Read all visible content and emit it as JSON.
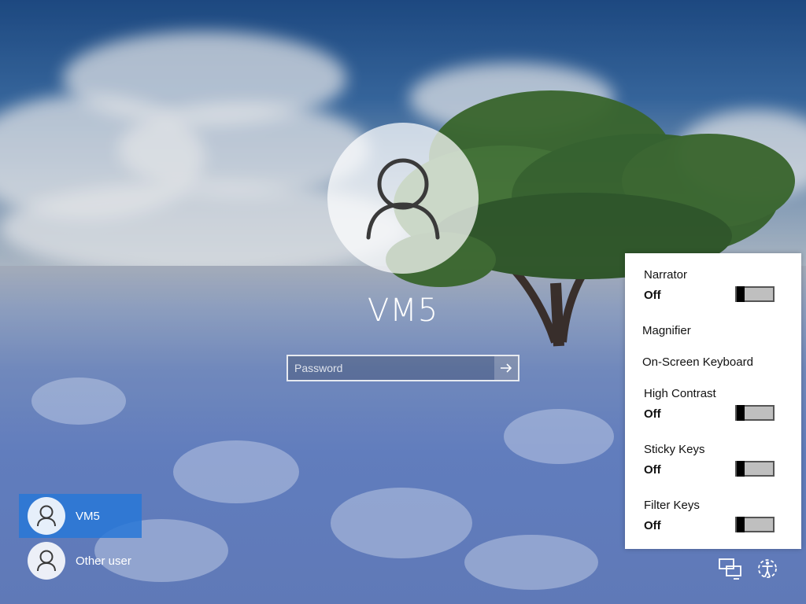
{
  "login": {
    "username": "VM5",
    "password_placeholder": "Password"
  },
  "users": [
    {
      "name": "VM5",
      "selected": true
    },
    {
      "name": "Other user",
      "selected": false
    }
  ],
  "ease_of_access": {
    "narrator": {
      "label": "Narrator",
      "state": "Off"
    },
    "magnifier": {
      "label": "Magnifier"
    },
    "onscreen_keyboard": {
      "label": "On-Screen Keyboard"
    },
    "high_contrast": {
      "label": "High Contrast",
      "state": "Off"
    },
    "sticky_keys": {
      "label": "Sticky Keys",
      "state": "Off"
    },
    "filter_keys": {
      "label": "Filter Keys",
      "state": "Off"
    }
  },
  "icons": {
    "user_avatar": "user-icon",
    "submit": "arrow-right-icon",
    "network": "network-icon",
    "ease_of_access": "ease-of-access-icon"
  },
  "colors": {
    "selected_user_bg": "#2878d7",
    "panel_bg": "#ffffff",
    "toggle_off": "#bfbfbf"
  }
}
